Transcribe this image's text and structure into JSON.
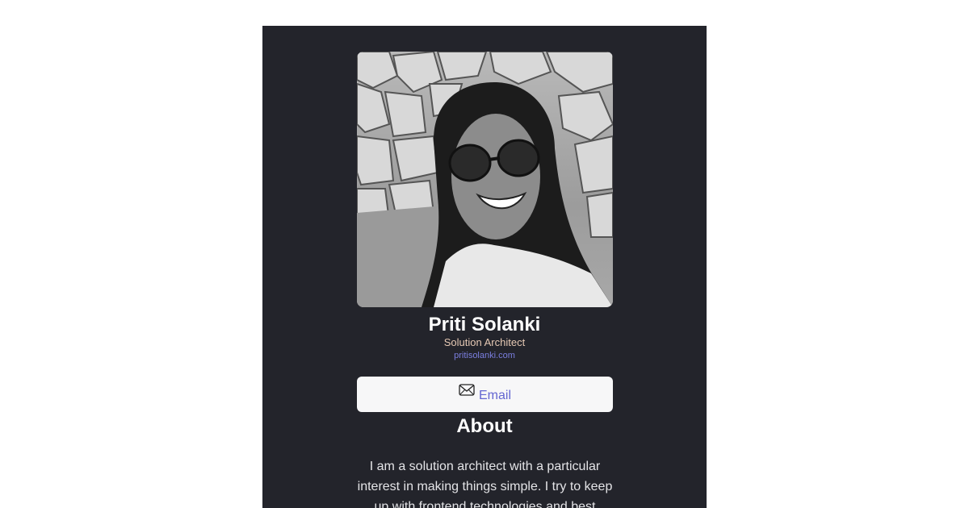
{
  "profile": {
    "photo_alt": "Priti Solanki",
    "name": "Priti Solanki",
    "role": "Solution Architect",
    "website": "pritisolanki.com"
  },
  "actions": {
    "email_label": "Email",
    "email_icon": "envelope-icon"
  },
  "about": {
    "heading": "About",
    "text": "I am a solution architect with a particular interest in making things simple. I try to keep up with frontend technologies and best"
  },
  "colors": {
    "page_background": "#ffffff",
    "card_background": "#23242b",
    "name": "#ffffff",
    "role": "#e6c9b4",
    "link": "#7b7fe0",
    "button_background": "#f7f7f8",
    "button_text": "#6366d1"
  }
}
